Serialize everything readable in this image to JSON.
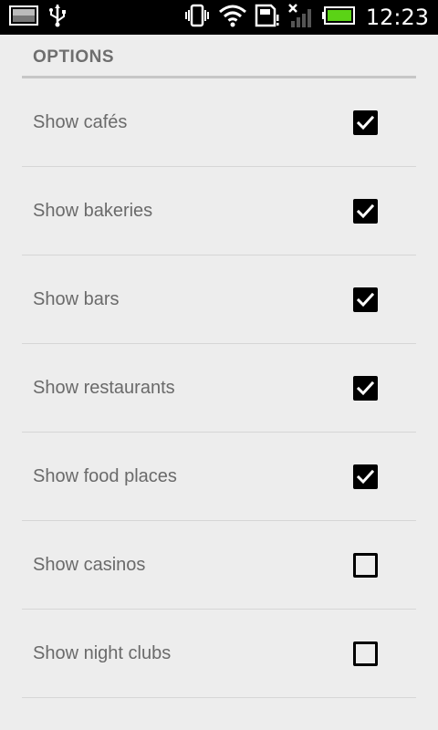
{
  "status_bar": {
    "time": "12:23",
    "icons_left": [
      "image-notification-icon",
      "usb-icon"
    ],
    "icons_right": [
      "vibrate-icon",
      "wifi-icon",
      "sd-card-icon",
      "signal-icon",
      "battery-icon"
    ],
    "battery_color": "#5bd316"
  },
  "options": {
    "header": "OPTIONS",
    "items": [
      {
        "label": "Show cafés",
        "checked": true
      },
      {
        "label": "Show bakeries",
        "checked": true
      },
      {
        "label": "Show bars",
        "checked": true
      },
      {
        "label": "Show restaurants",
        "checked": true
      },
      {
        "label": "Show food places",
        "checked": true
      },
      {
        "label": "Show casinos",
        "checked": false
      },
      {
        "label": "Show night clubs",
        "checked": false
      }
    ]
  }
}
